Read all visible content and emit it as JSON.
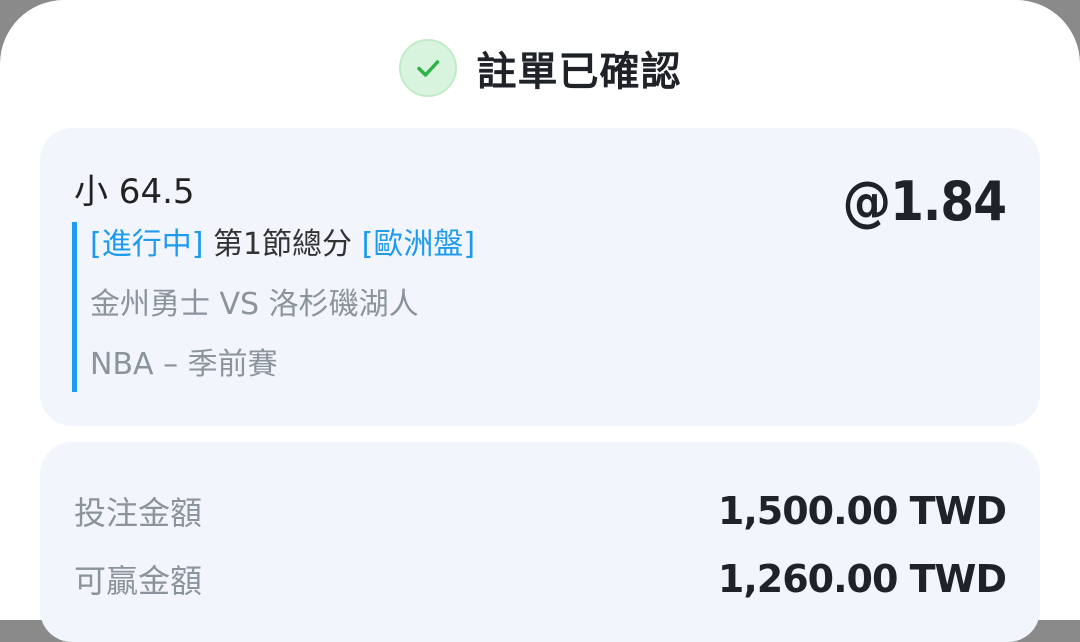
{
  "header": {
    "title": "註單已確認",
    "check_color": "#2fb24a"
  },
  "bet": {
    "selection": "小 64.5",
    "odds": "@1.84",
    "status": "[進行中]",
    "market": "第1節總分",
    "odds_format": "[歐洲盤]",
    "match": "金州勇士 VS 洛杉磯湖人",
    "league": "NBA – 季前賽"
  },
  "amounts": {
    "stake_label": "投注金額",
    "stake_value": "1,500.00 TWD",
    "win_label": "可贏金額",
    "win_value": "1,260.00 TWD"
  },
  "colors": {
    "accent": "#1e9bef",
    "card_bg": "#f2f6fc",
    "muted_text": "#8b939c"
  }
}
